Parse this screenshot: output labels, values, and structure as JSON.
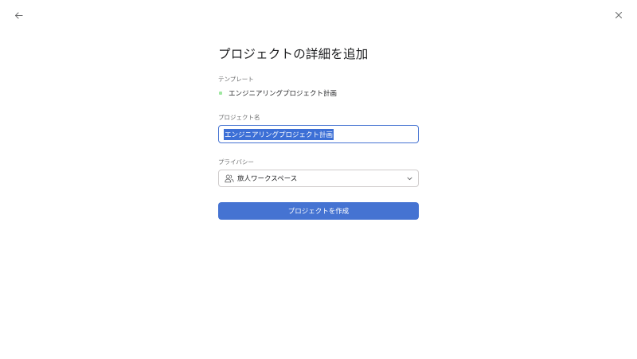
{
  "nav": {
    "back_icon": "arrow-left-icon",
    "close_icon": "close-icon"
  },
  "page": {
    "title": "プロジェクトの詳細を追加"
  },
  "template": {
    "label": "テンプレート",
    "name": "エンジニアリングプロジェクト計画",
    "dot_color": "#9ee7a0"
  },
  "project_name": {
    "label": "プロジェクト名",
    "value": "エンジニアリングプロジェクト計画"
  },
  "privacy": {
    "label": "プライバシー",
    "value": "旅人ワークスペース",
    "icon": "people-icon"
  },
  "create_button": {
    "label": "プロジェクトを作成",
    "color": "#4573d2"
  },
  "colors": {
    "accent": "#4573d2",
    "selection": "#3c6fd6",
    "label_gray": "#6d6e6f",
    "border": "#cfcbcb"
  }
}
